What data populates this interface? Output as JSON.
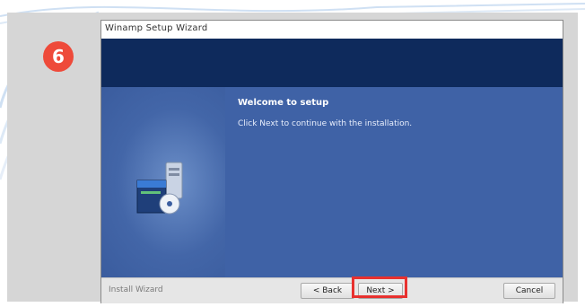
{
  "step": {
    "number": "6"
  },
  "window": {
    "title": "Winamp Setup Wizard",
    "heading": "Welcome to setup",
    "description": "Click Next to continue with the installation."
  },
  "footer": {
    "brand": "Install Wizard",
    "back_label": "< Back",
    "next_label": "Next >",
    "cancel_label": "Cancel"
  },
  "colors": {
    "badge": "#ee4a3a",
    "header_band": "#0e2a5c",
    "content_blue": "#3f62a6",
    "highlight": "#e8312f",
    "panel": "#d6d6d6"
  },
  "icons": {
    "installer": "installer-icon",
    "step_badge": "step-number-badge"
  }
}
